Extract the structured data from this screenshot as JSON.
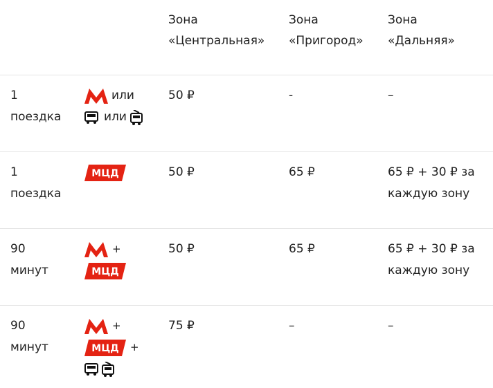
{
  "header": {
    "zone_central": [
      "Зона",
      "«Центральная»"
    ],
    "zone_suburb": [
      "Зона",
      "«Пригород»"
    ],
    "zone_far": [
      "Зона",
      "«Дальняя»"
    ]
  },
  "rows": [
    {
      "trip": [
        "1",
        "поездка"
      ],
      "transport": {
        "or_1": "или",
        "or_2": "или"
      },
      "central": "50 ₽",
      "suburb": "-",
      "far": [
        "–"
      ]
    },
    {
      "trip": [
        "1",
        "поездка"
      ],
      "central": "50 ₽",
      "suburb": "65 ₽",
      "far": [
        "65 ₽ + 30 ₽ за",
        "каждую зону"
      ]
    },
    {
      "trip": [
        "90",
        "минут"
      ],
      "transport": {
        "plus_1": "+"
      },
      "central": "50 ₽",
      "suburb": "65 ₽",
      "far": [
        "65 ₽ + 30 ₽ за",
        "каждую зону"
      ]
    },
    {
      "trip": [
        "90",
        "минут"
      ],
      "transport": {
        "plus_1": "+",
        "plus_2": "+"
      },
      "central": "75 ₽",
      "suburb": "–",
      "far": [
        "–"
      ]
    }
  ],
  "icons": {
    "metro": "metro-icon",
    "mcd": "mcd-icon",
    "mcd_label": "МЦД",
    "bus": "bus-icon",
    "tram": "tram-icon"
  },
  "colors": {
    "brand_red": "#e42313",
    "text": "#222222",
    "separator": "#e3e3e3"
  }
}
